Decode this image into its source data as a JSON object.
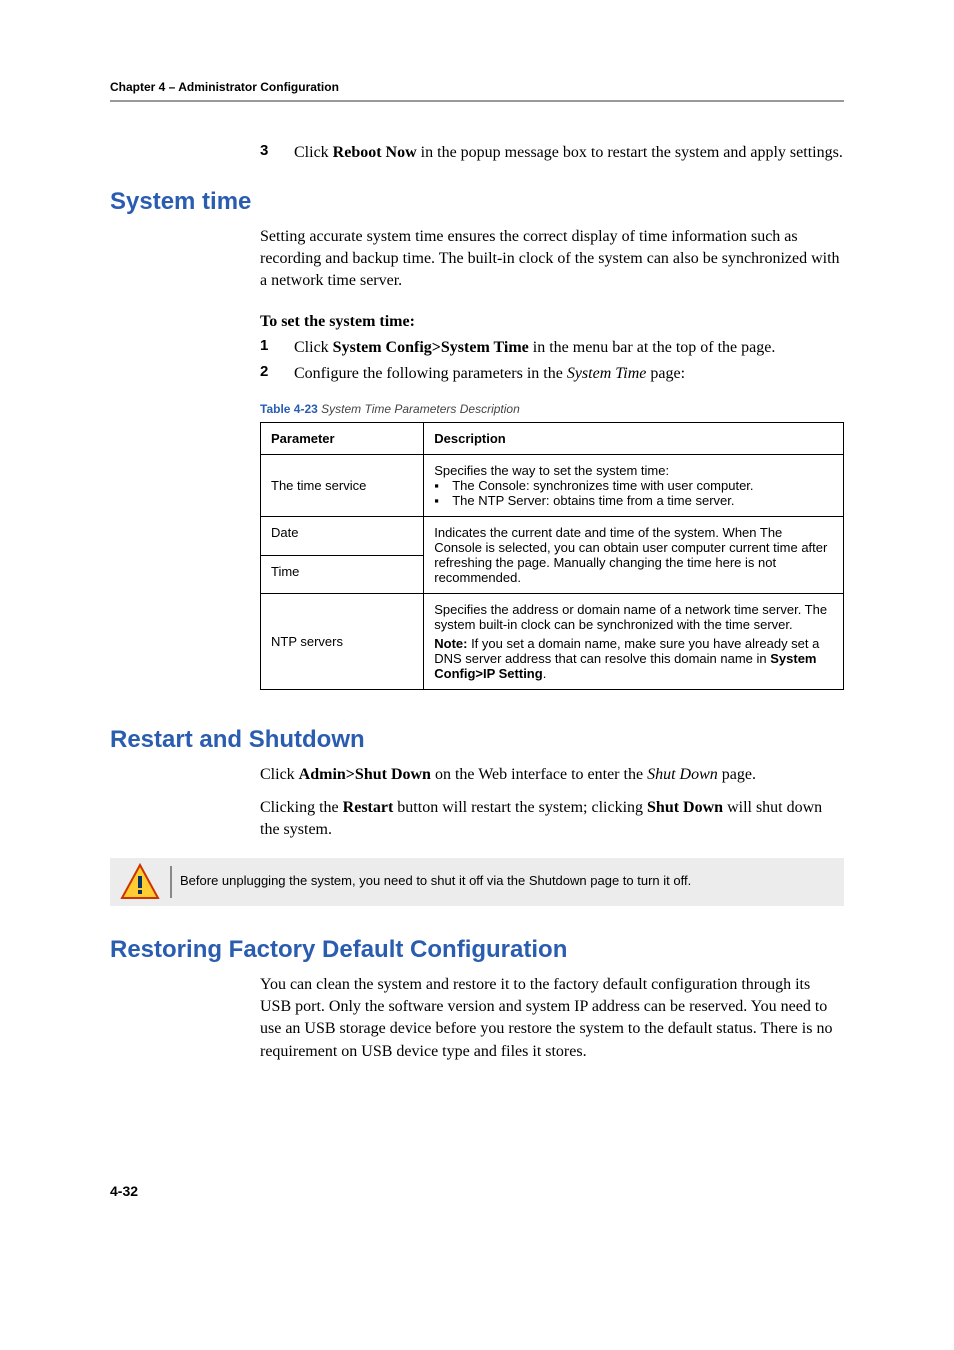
{
  "header": "Chapter 4 – Administrator Configuration",
  "intro_step": {
    "num": "3",
    "pre": "Click ",
    "bold": "Reboot Now",
    "post": " in the popup message box to restart the system and apply settings."
  },
  "system_time": {
    "heading": "System time",
    "para": "Setting accurate system time ensures the correct display of time information such as recording and backup time. The built-in clock of the system can also be synchronized with a network time server.",
    "proc_title": "To set the system time:",
    "step1": {
      "num": "1",
      "pre": "Click ",
      "bold": "System Config>System Time",
      "post": " in the menu bar at the top of the page."
    },
    "step2": {
      "num": "2",
      "pre": "Configure the following parameters in the ",
      "italic": "System Time",
      "post": " page:"
    },
    "table_caption_label": "Table 4-23",
    "table_caption_desc": " System Time Parameters Description",
    "th_param": "Parameter",
    "th_desc": "Description",
    "row1": {
      "param": "The time service",
      "line1": "Specifies the way to set the system time:",
      "bullet1": "The Console: synchronizes time with user computer.",
      "bullet2": "The NTP Server: obtains time from a time server."
    },
    "row2a_param": "Date",
    "row2b_param": "Time",
    "row2_desc_a": "Indicates the current date and time of the system. When The Console is selected, you can obtain user computer",
    "row2_desc_b": "current time after refreshing the page. Manually changing the time here is not recommended.",
    "row3": {
      "param": "NTP servers",
      "line1": "Specifies the address or domain name of a network time server. The system built-in clock can be synchronized with the time server.",
      "note_label": "Note:",
      "note_rest": " If you set a domain name, make sure you have already set a DNS server address that can resolve this domain name in ",
      "note_bold2": "System Config>IP Setting",
      "note_end": "."
    }
  },
  "restart": {
    "heading": "Restart and Shutdown",
    "p1_pre": "Click ",
    "p1_b1": "Admin>Shut Down",
    "p1_mid": " on the Web interface to enter the ",
    "p1_i1": "Shut Down",
    "p1_post": " page.",
    "p2_pre": "Clicking the ",
    "p2_b1": "Restart",
    "p2_mid": " button will restart the system; clicking ",
    "p2_b2": "Shut Down",
    "p2_post": " will shut down the system.",
    "callout": "Before unplugging the system, you need to shut it off via the Shutdown page to turn it off."
  },
  "restore": {
    "heading": "Restoring Factory Default Configuration",
    "para": "You can clean the system and restore it to the factory default configuration through its USB port. Only the software version and system IP address can be reserved. You need to use an USB storage device before you restore the system to the default status. There is no requirement on USB device type and files it stores."
  },
  "page_num": "4-32"
}
